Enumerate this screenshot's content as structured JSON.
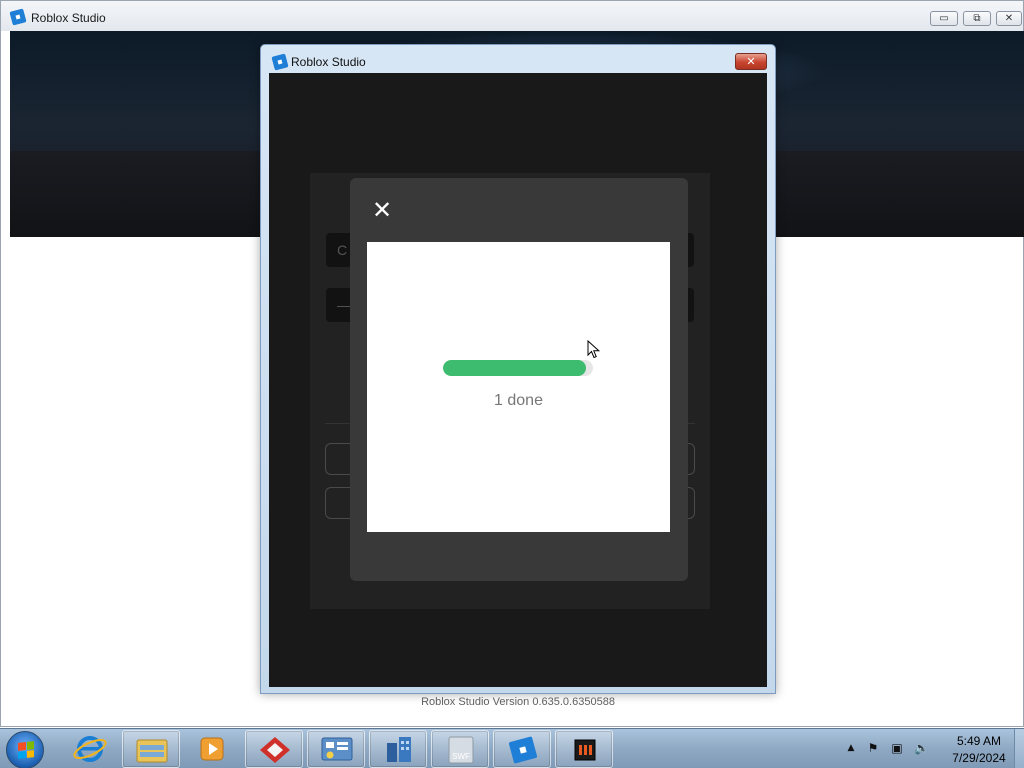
{
  "main_window": {
    "title": "Roblox Studio",
    "controls": {
      "minimize": "▭",
      "restore": "⧉",
      "close": "✕"
    }
  },
  "dialog": {
    "title": "Roblox Studio",
    "close_glyph": "✕",
    "background_field_1": "C",
    "background_field_2": "—"
  },
  "modal": {
    "close_glyph": "✕",
    "progress_value": 0.95,
    "progress_label": "1 done",
    "progress_color": "#3dbb6e"
  },
  "footer": {
    "version_text": "Roblox Studio Version 0.635.0.6350588"
  },
  "taskbar": {
    "items": [
      {
        "name": "internet-explorer-icon",
        "active": false
      },
      {
        "name": "file-explorer-icon",
        "active": true
      },
      {
        "name": "media-player-icon",
        "active": false
      },
      {
        "name": "red-app-icon",
        "active": true
      },
      {
        "name": "control-panel-icon",
        "active": true
      },
      {
        "name": "building-app-icon",
        "active": true
      },
      {
        "name": "swf-app-icon",
        "active": true
      },
      {
        "name": "roblox-studio-icon",
        "active": true
      },
      {
        "name": "dark-app-icon",
        "active": true
      }
    ],
    "swf_label": "SWF",
    "clock": {
      "time": "5:49 AM",
      "date": "7/29/2024"
    },
    "tray": {
      "arrow": "▲",
      "flag": "⚑",
      "network": "▣",
      "volume": "🔈"
    }
  }
}
